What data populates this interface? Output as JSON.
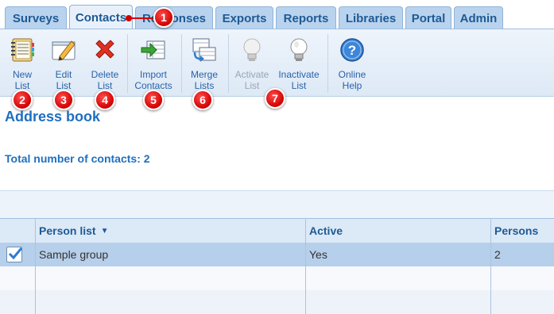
{
  "tabs": [
    {
      "label": "Surveys"
    },
    {
      "label": "Contacts"
    },
    {
      "label": "Responses"
    },
    {
      "label": "Exports"
    },
    {
      "label": "Reports"
    },
    {
      "label": "Libraries"
    },
    {
      "label": "Portal"
    },
    {
      "label": "Admin"
    }
  ],
  "tabs_active": "Contacts",
  "toolbar": {
    "new_list": {
      "line1": "New",
      "line2": "List"
    },
    "edit_list": {
      "line1": "Edit",
      "line2": "List"
    },
    "delete_list": {
      "line1": "Delete",
      "line2": "List"
    },
    "import_contacts": {
      "line1": "Import",
      "line2": "Contacts"
    },
    "merge_lists": {
      "line1": "Merge",
      "line2": "Lists"
    },
    "activate_list": {
      "line1": "Activate",
      "line2": "List"
    },
    "inactivate_list": {
      "line1": "Inactivate",
      "line2": "List"
    },
    "online_help": {
      "line1": "Online",
      "line2": "Help"
    }
  },
  "badges": [
    "1",
    "2",
    "3",
    "4",
    "5",
    "6",
    "7"
  ],
  "page": {
    "title": "Address book",
    "count_text": "Total number of contacts: 2"
  },
  "table": {
    "headers": {
      "person_list": "Person list",
      "sort_indicator": "▼",
      "active": "Active",
      "persons": "Persons"
    },
    "rows": [
      {
        "checked": true,
        "person_list": "Sample group",
        "active": "Yes",
        "persons": "2"
      }
    ]
  },
  "colors": {
    "accent": "#1f6fc0",
    "badge": "#d20000",
    "tab_bg": "#b9d3ee",
    "selected_row": "#b6cfea"
  }
}
